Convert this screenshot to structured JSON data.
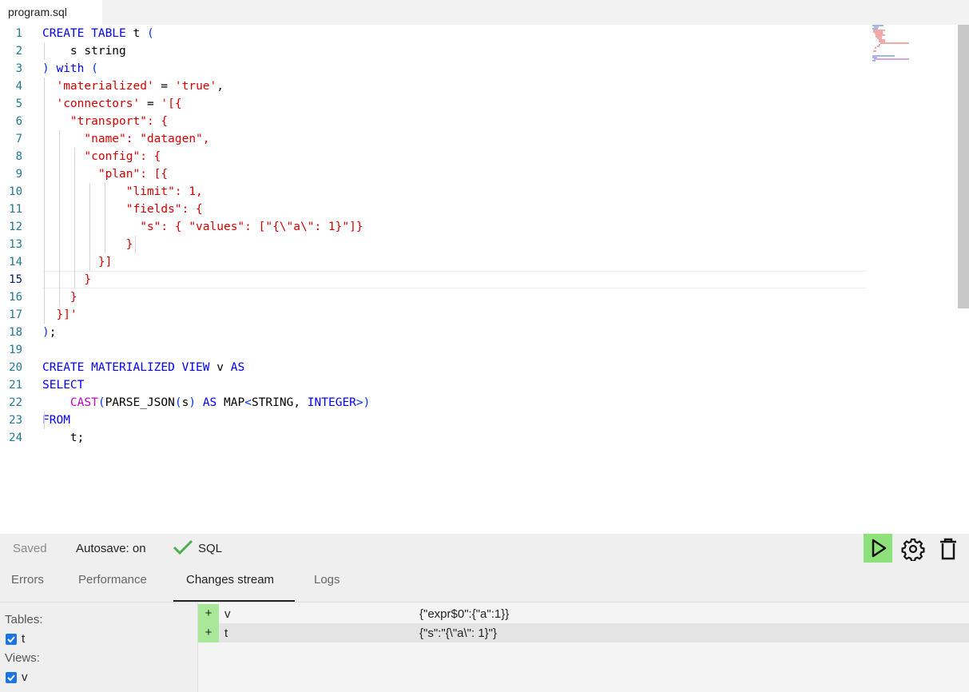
{
  "tab": {
    "title": "program.sql"
  },
  "editor": {
    "lines": [
      [
        {
          "t": "CREATE TABLE ",
          "c": "kw"
        },
        {
          "t": "t ",
          "c": ""
        },
        {
          "t": "(",
          "c": "br"
        }
      ],
      [
        {
          "t": "    s string",
          "c": ""
        }
      ],
      [
        {
          "t": ")",
          "c": "br"
        },
        {
          "t": " with ",
          "c": "kw"
        },
        {
          "t": "(",
          "c": "br"
        }
      ],
      [
        {
          "t": "  'materialized'",
          "c": "str"
        },
        {
          "t": " = ",
          "c": ""
        },
        {
          "t": "'true'",
          "c": "str"
        },
        {
          "t": ",",
          "c": ""
        }
      ],
      [
        {
          "t": "  'connectors'",
          "c": "str"
        },
        {
          "t": " = ",
          "c": ""
        },
        {
          "t": "'[{",
          "c": "str"
        }
      ],
      [
        {
          "t": "    \"transport\": {",
          "c": "str"
        }
      ],
      [
        {
          "t": "      \"name\": \"datagen\",",
          "c": "str"
        }
      ],
      [
        {
          "t": "      \"config\": {",
          "c": "str"
        }
      ],
      [
        {
          "t": "        \"plan\": [{",
          "c": "str"
        }
      ],
      [
        {
          "t": "            \"limit\": 1,",
          "c": "str"
        }
      ],
      [
        {
          "t": "            \"fields\": {",
          "c": "str"
        }
      ],
      [
        {
          "t": "              \"s\": { \"values\": [\"{\\\"a\\\": 1}\"]}",
          "c": "str"
        }
      ],
      [
        {
          "t": "            }",
          "c": "str"
        }
      ],
      [
        {
          "t": "        }]",
          "c": "str"
        }
      ],
      [
        {
          "t": "      }",
          "c": "str"
        }
      ],
      [
        {
          "t": "    }",
          "c": "str"
        }
      ],
      [
        {
          "t": "  }]'",
          "c": "str"
        }
      ],
      [
        {
          "t": ")",
          "c": "br"
        },
        {
          "t": ";",
          "c": ""
        }
      ],
      [
        {
          "t": "",
          "c": ""
        }
      ],
      [
        {
          "t": "CREATE MATERIALIZED VIEW ",
          "c": "kw"
        },
        {
          "t": "v ",
          "c": ""
        },
        {
          "t": "AS",
          "c": "kw"
        }
      ],
      [
        {
          "t": "SELECT",
          "c": "kw"
        }
      ],
      [
        {
          "t": "    ",
          "c": ""
        },
        {
          "t": "CAST",
          "c": "fn"
        },
        {
          "t": "(",
          "c": "br"
        },
        {
          "t": "PARSE_JSON",
          "c": ""
        },
        {
          "t": "(",
          "c": "br"
        },
        {
          "t": "s",
          "c": ""
        },
        {
          "t": ")",
          "c": "br"
        },
        {
          "t": " AS ",
          "c": "kw"
        },
        {
          "t": "MAP",
          "c": ""
        },
        {
          "t": "<",
          "c": "br"
        },
        {
          "t": "STRING, ",
          "c": ""
        },
        {
          "t": "INTEGER",
          "c": "kw"
        },
        {
          "t": ">)",
          "c": "br"
        }
      ],
      [
        {
          "t": "FROM",
          "c": "kw"
        }
      ],
      [
        {
          "t": "    t;",
          "c": ""
        }
      ]
    ],
    "line_numbers": [
      "1",
      "2",
      "3",
      "4",
      "5",
      "6",
      "7",
      "8",
      "9",
      "10",
      "11",
      "12",
      "13",
      "14",
      "15",
      "16",
      "17",
      "18",
      "19",
      "20",
      "21",
      "22",
      "23",
      "24"
    ],
    "active_line": 15
  },
  "status": {
    "saved": "Saved",
    "autosave": "Autosave: on",
    "sql": "SQL"
  },
  "bottom_tabs": {
    "errors": "Errors",
    "performance": "Performance",
    "changes": "Changes stream",
    "logs": "Logs",
    "active": "changes"
  },
  "relations": {
    "tables_label": "Tables:",
    "tables": [
      "t"
    ],
    "views_label": "Views:",
    "views": [
      "v"
    ]
  },
  "changes": [
    {
      "sign": "+",
      "name": "v",
      "value": "{\"expr$0\":{\"a\":1}}"
    },
    {
      "sign": "+",
      "name": "t",
      "value": "{\"s\":\"{\\\"a\\\": 1}\"}"
    }
  ],
  "colors": {
    "run_button": "#8ee07a",
    "plus_cell": "#a8e898",
    "checkbox": "#1a73e8"
  }
}
